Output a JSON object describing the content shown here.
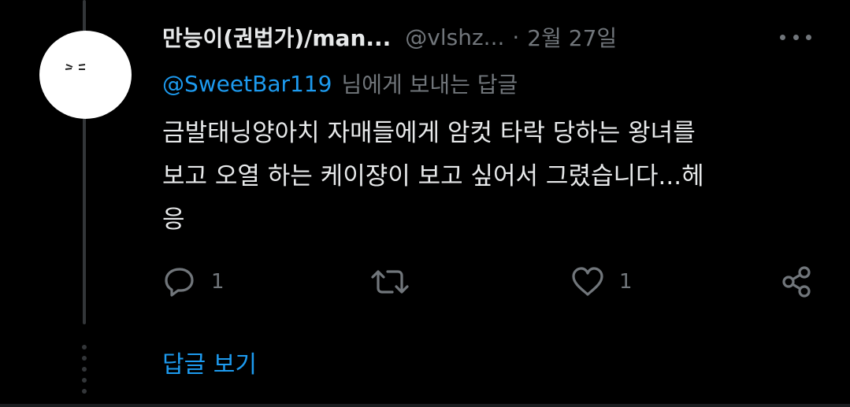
{
  "tweet": {
    "display_name": "만능이(권법가)/man...",
    "handle": "@vlshz...",
    "separator": "·",
    "date": "2월 27일",
    "reply_mention": "@SweetBar119",
    "reply_suffix": "님에게 보내는 답글",
    "text_lines": [
      "금발태닝양아치 자매들에게 암컷 타락 당하는 왕녀를",
      "보고 오열 하는 케이쟝이 보고 싶어서 그렸습니다...헤",
      "응"
    ]
  },
  "actions": {
    "reply_count": "1",
    "retweet_count": "",
    "like_count": "1"
  },
  "footer": {
    "view_replies": "답글 보기"
  },
  "icons": {
    "more": "more-horizontal-icon",
    "reply": "reply-icon",
    "retweet": "retweet-icon",
    "like": "heart-icon",
    "share": "share-icon"
  },
  "colors": {
    "background": "#000000",
    "text": "#e7e9ea",
    "muted": "#71767b",
    "accent": "#1d9bf0"
  }
}
